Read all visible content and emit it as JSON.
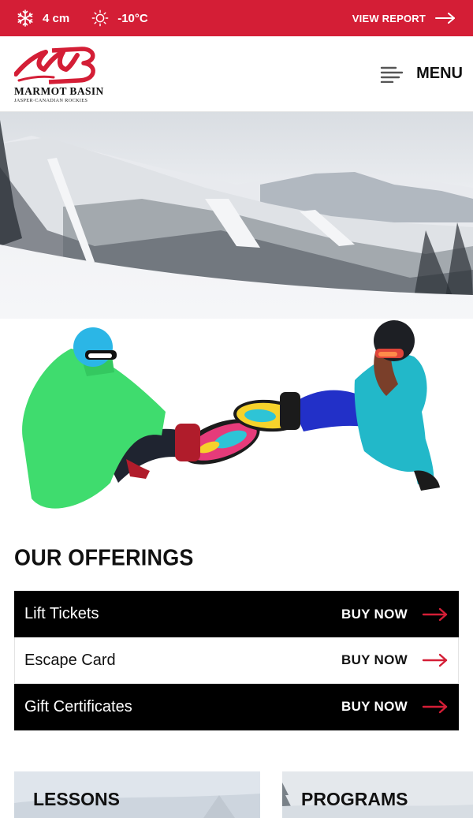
{
  "conditions": {
    "snow_icon": "snowflake-icon",
    "snow": "4 cm",
    "temp_icon": "sun-icon",
    "temperature": "-10°C",
    "report_label": "VIEW REPORT"
  },
  "brand": {
    "name": "MARMOT BASIN",
    "tagline": "JASPER·CANADIAN ROCKIES",
    "accent": "#d41e36"
  },
  "nav": {
    "menu_label": "MENU",
    "menu_icon": "hamburger-icon"
  },
  "offerings": {
    "title": "OUR OFFERINGS",
    "items": [
      {
        "label": "Lift Tickets",
        "action": "BUY NOW"
      },
      {
        "label": "Escape Card",
        "action": "BUY NOW"
      },
      {
        "label": "Gift Certificates",
        "action": "BUY NOW"
      }
    ]
  },
  "cards": [
    {
      "label": "LESSONS"
    },
    {
      "label": "PROGRAMS"
    }
  ]
}
